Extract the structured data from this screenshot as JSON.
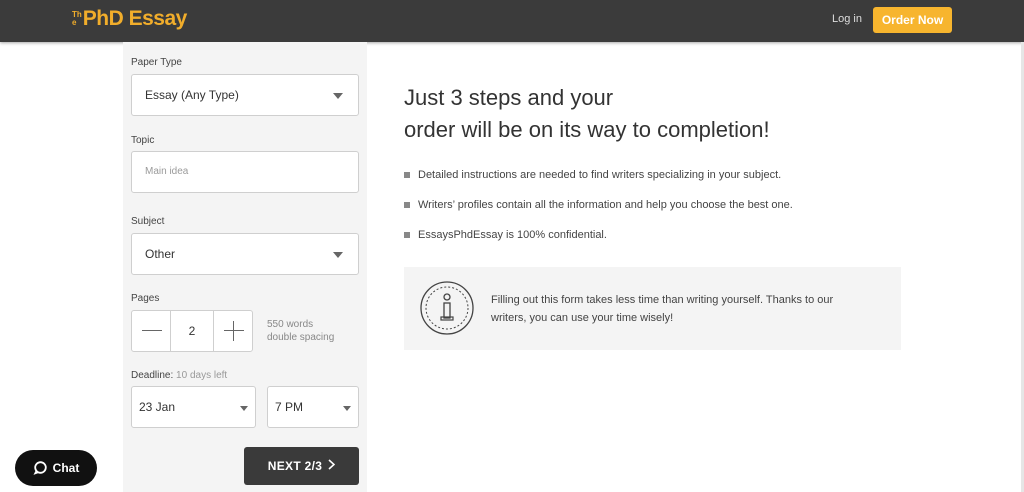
{
  "header": {
    "logo_small_top": "Th",
    "logo_small_bottom": "e",
    "logo_main": "PhD Essay",
    "login_label": "Log in",
    "order_label": "Order Now"
  },
  "form": {
    "paper_type": {
      "label": "Paper Type",
      "value": "Essay (Any Type)"
    },
    "topic": {
      "label": "Topic",
      "placeholder": "Main idea"
    },
    "subject": {
      "label": "Subject",
      "value": "Other"
    },
    "pages": {
      "label": "Pages",
      "value": "2",
      "words": "550 words",
      "spacing": "double spacing"
    },
    "deadline": {
      "label": "Deadline:",
      "note": "10 days left",
      "date": "23 Jan",
      "time": "7 PM"
    },
    "next_label": "NEXT 2/3"
  },
  "content": {
    "heading_line1": "Just 3 steps and your",
    "heading_line2": "order will be on its way to completion!",
    "bullets": [
      "Detailed instructions are needed to find writers specializing in your subject.",
      "Writers’ profiles contain all the information and help you choose the best one.",
      "EssaysPhdEssay is 100% confidential."
    ],
    "info_text": "Filling out this form takes less time than writing yourself. Thanks to our writers, you can use your time wisely!"
  },
  "chat": {
    "label": "Chat"
  },
  "colors": {
    "accent": "#f7b52e",
    "header_bg": "#3b3b3b",
    "form_bg": "#f4f4f4",
    "dark_button": "#3a3a3a"
  }
}
